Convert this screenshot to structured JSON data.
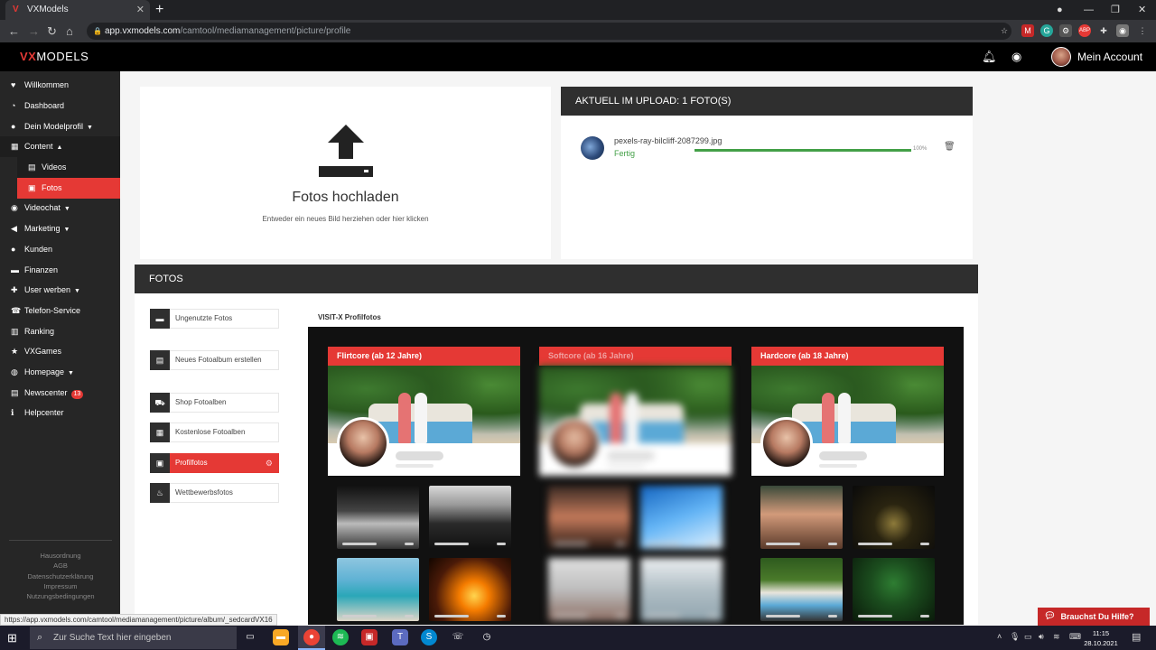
{
  "browser": {
    "tab_title": "VXModels",
    "tab_favicon": "vx-logo-icon",
    "url_host": "app.vxmodels.com",
    "url_path": "/camtool/mediamanagement/picture/profile",
    "status_url": "https://app.vxmodels.com/camtool/mediamanagement/picture/album/_sedcardVX16"
  },
  "header": {
    "logo_vx": "VX",
    "logo_rest": "MODELS",
    "account_label": "Mein Account",
    "brand_color": "#e53935"
  },
  "sidebar": {
    "items": [
      {
        "label": "Willkommen",
        "icon": "heart-icon"
      },
      {
        "label": "Dashboard",
        "icon": "gauge-icon"
      },
      {
        "label": "Dein Modelprofil",
        "icon": "user-icon"
      },
      {
        "label": "Content",
        "icon": "film-icon"
      },
      {
        "label": "Videos",
        "icon": "video-icon"
      },
      {
        "label": "Fotos",
        "icon": "image-icon"
      },
      {
        "label": "Videochat",
        "icon": "webcam-icon"
      },
      {
        "label": "Marketing",
        "icon": "megaphone-icon"
      },
      {
        "label": "Kunden",
        "icon": "users-icon"
      },
      {
        "label": "Finanzen",
        "icon": "money-icon"
      },
      {
        "label": "User werben",
        "icon": "user-plus-icon"
      },
      {
        "label": "Telefon-Service",
        "icon": "phone-icon"
      },
      {
        "label": "Ranking",
        "icon": "chart-icon"
      },
      {
        "label": "VXGames",
        "icon": "star-icon"
      },
      {
        "label": "Homepage",
        "icon": "globe-icon"
      },
      {
        "label": "Newscenter",
        "icon": "news-icon",
        "badge": "13"
      },
      {
        "label": "Helpcenter",
        "icon": "info-icon"
      }
    ],
    "footer": [
      "Hausordnung",
      "AGB",
      "Datenschutzerklärung",
      "Impressum",
      "Nutzungsbedingungen"
    ]
  },
  "upload": {
    "title": "Fotos hochladen",
    "subtitle": "Entweder ein neues Bild herziehen oder hier klicken",
    "panel_title": "AKTUELL IM UPLOAD: 1 FOTO(S)",
    "file_name": "pexels-ray-bilcliff-2087299.jpg",
    "file_status": "Fertig",
    "progress": 1.0,
    "progress_label": "100%"
  },
  "fotos": {
    "title": "FOTOS",
    "menu": [
      {
        "label": "Ungenutzte Fotos",
        "icon": "folder-icon"
      },
      {
        "label": "Neues Fotoalbum erstellen",
        "icon": "album-add-icon"
      },
      {
        "label": "Shop Fotoalben",
        "icon": "cart-icon"
      },
      {
        "label": "Kostenlose Fotoalben",
        "icon": "grid-icon"
      },
      {
        "label": "Profilfotos",
        "icon": "profile-photo-icon"
      },
      {
        "label": "Wettbewerbsfotos",
        "icon": "flame-icon"
      }
    ],
    "gallery_title": "VISIT-X Profilfotos",
    "columns": [
      {
        "label": "Flirtcore (ab 12 Jahre)"
      },
      {
        "label": "Softcore (ab 16 Jahre)"
      },
      {
        "label": "Hardcore (ab 18 Jahre)"
      }
    ]
  },
  "help": {
    "label": "Brauchst Du Hilfe?"
  },
  "taskbar": {
    "search_placeholder": "Zur Suche Text hier eingeben",
    "time": "11:15",
    "date": "28.10.2021"
  }
}
